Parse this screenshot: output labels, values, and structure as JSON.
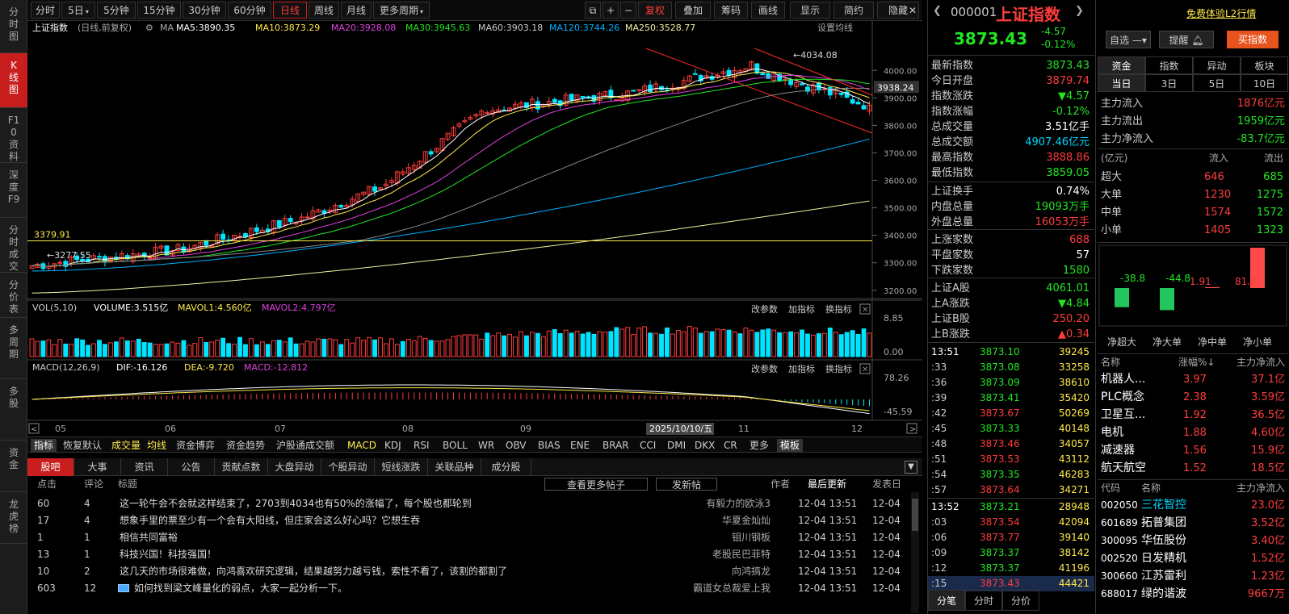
{
  "left_nav": [
    "分时图",
    "K线图",
    "F10资料",
    "深度F9",
    "分时成交",
    "分价表",
    "多周期",
    "多股",
    "资金",
    "龙虎榜"
  ],
  "toolbar": {
    "periods": [
      "分时",
      "5日",
      "5分钟",
      "15分钟",
      "30分钟",
      "60分钟",
      "日线",
      "周线",
      "月线",
      "更多周期"
    ],
    "active": "日线",
    "tools": [
      "复权",
      "叠加",
      "筹码",
      "画线",
      "显示",
      "简约",
      "隐藏"
    ]
  },
  "chart_info": {
    "name": "上证指数",
    "mode": "(日线,前复权)",
    "ma_label": "MA",
    "ma5": "MA5:3890.35",
    "ma10": "MA10:3873.29",
    "ma20": "MA20:3928.08",
    "ma30": "MA30:3945.63",
    "ma60": "MA60:3903.18",
    "ma120": "MA120:3744.26",
    "ma250": "MA250:3528.77",
    "set_ma": "设置均线",
    "current_price_tag": "3938.24",
    "high_note": "4034.08",
    "low_note": "3277.55",
    "hline_label": "3379.91",
    "cursor_date": "2025/10/10/五"
  },
  "colors": {
    "up": "#ff3c3c",
    "down": "#00e5ff",
    "ma5": "#ffffff",
    "ma10": "#ffe94a",
    "ma20": "#e040e0",
    "ma30": "#22e522",
    "ma60": "#888888",
    "ma120": "#00aeff",
    "ma250": "#f0f0a0"
  },
  "vol_info": {
    "label": "VOL(5,10)",
    "volume": "VOLUME:3.515亿",
    "mavol1": "MAVOL1:4.560亿",
    "mavol2": "MAVOL2:4.797亿",
    "ticks": [
      "8.85",
      "0.00"
    ]
  },
  "macd_info": {
    "label": "MACD(12,26,9)",
    "dif": "DIF:-16.126",
    "dea": "DEA:-9.720",
    "macd": "MACD:-12.812",
    "ticks": [
      "78.26",
      "-45.59"
    ]
  },
  "panel_buttons": [
    "改参数",
    "加指标",
    "换指标"
  ],
  "chart_data": {
    "type": "candlestick",
    "x_labels": [
      "05",
      "06",
      "07",
      "08",
      "09",
      "10",
      "11",
      "12"
    ],
    "y_ticks": [
      4000,
      3900,
      3800,
      3700,
      3600,
      3500,
      3400,
      3300,
      3200
    ],
    "ylim": [
      3170,
      4080
    ],
    "high": 4034.08,
    "low": 3277.55,
    "hline": 3379.91,
    "last_close": 3873.43
  },
  "indicators": [
    "指标",
    "恢复默认",
    "成交量",
    "均线",
    "资金博弈",
    "资金趋势",
    "沪股通成交额",
    "MACD",
    "KDJ",
    "RSI",
    "BOLL",
    "WR",
    "OBV",
    "BIAS",
    "ENE",
    "BRAR",
    "CCI",
    "DMI",
    "DKX",
    "CR",
    "更多",
    "模板"
  ],
  "news_tabs": [
    "股吧",
    "大事",
    "资讯",
    "公告",
    "贡献点数",
    "大盘异动",
    "个股异动",
    "短线涨跌",
    "关联品种",
    "成分股"
  ],
  "news_header": {
    "clicks": "点击",
    "comments": "评论",
    "title": "标题",
    "more": "查看更多帖子",
    "post": "发新帖",
    "author": "作者",
    "updated": "最后更新",
    "posted": "发表日"
  },
  "news": [
    {
      "clicks": "60",
      "comments": "4",
      "title": "这一轮牛会不会就这样结束了，2703到4034也有50%的涨幅了，每个股也都轮到",
      "author": "有毅力的欧泳3",
      "updated": "12-04 13:51",
      "posted": "12-04"
    },
    {
      "clicks": "17",
      "comments": "4",
      "title": "想象手里的票至少有一个会有大阳线，但庄家会这么好心吗？它想生吞",
      "author": "华夏金灿灿",
      "updated": "12-04 13:51",
      "posted": "12-04"
    },
    {
      "clicks": "1",
      "comments": "1",
      "title": "相信共同富裕",
      "author": "钼川钢板",
      "updated": "12-04 13:51",
      "posted": "12-04"
    },
    {
      "clicks": "13",
      "comments": "1",
      "title": "科技兴国！科技强国！",
      "author": "老股民巴菲特",
      "updated": "12-04 13:51",
      "posted": "12-04"
    },
    {
      "clicks": "10",
      "comments": "2",
      "title": "这几天的市场很难做，向鸿喜欢研究逻辑，结果越努力越亏钱，索性不看了，该割的都割了",
      "author": "向鸿搞龙",
      "updated": "12-04 13:51",
      "posted": "12-04"
    },
    {
      "clicks": "603",
      "comments": "12",
      "title": "如何找到梁文峰量化的弱点，大家一起分析一下。",
      "author": "霸道女总裁爱上我",
      "updated": "12-04 13:51",
      "posted": "12-04"
    }
  ],
  "quote": {
    "code": "000001",
    "name": "上证指数",
    "price": "3873.43",
    "change": "-4.57",
    "pct": "-0.12%",
    "rows": [
      {
        "k": "最新指数",
        "v": "3873.43",
        "c": "green"
      },
      {
        "k": "今日开盘",
        "v": "3879.74",
        "c": "red"
      },
      {
        "k": "指数涨跌",
        "v": "▼4.57",
        "c": "green"
      },
      {
        "k": "指数涨幅",
        "v": "-0.12%",
        "c": "green"
      },
      {
        "k": "总成交量",
        "v": "3.51亿手",
        "c": "white"
      },
      {
        "k": "总成交额",
        "v": "4907.46亿元",
        "c": "cyan"
      },
      {
        "k": "最高指数",
        "v": "3888.86",
        "c": "red"
      },
      {
        "k": "最低指数",
        "v": "3859.05",
        "c": "green"
      },
      {
        "k": "上证换手",
        "v": "0.74%",
        "c": "white"
      },
      {
        "k": "内盘总量",
        "v": "19093万手",
        "c": "green"
      },
      {
        "k": "外盘总量",
        "v": "16053万手",
        "c": "red"
      },
      {
        "k": "上涨家数",
        "v": "688",
        "c": "red"
      },
      {
        "k": "平盘家数",
        "v": "57",
        "c": "white"
      },
      {
        "k": "下跌家数",
        "v": "1580",
        "c": "green"
      },
      {
        "k": "上证A股",
        "v": "4061.01",
        "c": "green"
      },
      {
        "k": "上A涨跌",
        "v": "▼4.84",
        "c": "green"
      },
      {
        "k": "上证B股",
        "v": "250.20",
        "c": "red"
      },
      {
        "k": "上B涨跌",
        "v": "▲0.34",
        "c": "red"
      }
    ],
    "ticks1_time": "13:51",
    "ticks1": [
      {
        "t": "13:51",
        "p": "3873.10",
        "q": "39245"
      },
      {
        "t": ":33",
        "p": "3873.08",
        "q": "33258"
      },
      {
        "t": ":36",
        "p": "3873.09",
        "q": "38610"
      },
      {
        "t": ":39",
        "p": "3873.41",
        "q": "35420"
      },
      {
        "t": ":42",
        "p": "3873.67",
        "q": "50269"
      },
      {
        "t": ":45",
        "p": "3873.33",
        "q": "40148"
      },
      {
        "t": ":48",
        "p": "3873.46",
        "q": "34057"
      },
      {
        "t": ":51",
        "p": "3873.53",
        "q": "43112"
      },
      {
        "t": ":54",
        "p": "3873.35",
        "q": "46283"
      },
      {
        "t": ":57",
        "p": "3873.64",
        "q": "34271"
      }
    ],
    "ticks2": [
      {
        "t": "13:52",
        "p": "3873.21",
        "q": "28948"
      },
      {
        "t": ":03",
        "p": "3873.54",
        "q": "42094"
      },
      {
        "t": ":06",
        "p": "3873.77",
        "q": "39140"
      },
      {
        "t": ":09",
        "p": "3873.37",
        "q": "38142"
      },
      {
        "t": ":12",
        "p": "3873.37",
        "q": "41196"
      },
      {
        "t": ":15",
        "p": "3873.43",
        "q": "44421"
      }
    ],
    "bottom_tabs": [
      "分笔",
      "分时",
      "分价"
    ]
  },
  "fund": {
    "top_link": "免费体验L2行情",
    "watch": "自选",
    "alert": "提醒",
    "buy": "买指数",
    "tabs1": [
      "资金",
      "指数",
      "异动",
      "板块"
    ],
    "tabs2": [
      "当日",
      "3日",
      "5日",
      "10日"
    ],
    "flows": [
      {
        "k": "主力流入",
        "v": "1876亿元",
        "c": "red"
      },
      {
        "k": "主力流出",
        "v": "1959亿元",
        "c": "green"
      },
      {
        "k": "主力净流入",
        "v": "-83.7亿元",
        "c": "green"
      }
    ],
    "flow_head": {
      "unit": "(亿元)",
      "in": "流入",
      "out": "流出"
    },
    "flow_rows": [
      {
        "k": "超大",
        "in": "646",
        "out": "685"
      },
      {
        "k": "大单",
        "in": "1230",
        "out": "1275"
      },
      {
        "k": "中单",
        "in": "1574",
        "out": "1572"
      },
      {
        "k": "小单",
        "in": "1405",
        "out": "1323"
      }
    ],
    "bars": [
      {
        "label": "净超大",
        "value": -38.8,
        "text": "-38.8"
      },
      {
        "label": "净大单",
        "value": -44.8,
        "text": "-44.8"
      },
      {
        "label": "净中单",
        "value": 1.91,
        "text": "1.91"
      },
      {
        "label": "净小单",
        "value": 81.8,
        "text": "81.8"
      }
    ],
    "sector_head": {
      "name": "名称",
      "pct": "涨幅%↓",
      "net": "主力净流入"
    },
    "sectors": [
      {
        "n": "机器人...",
        "p": "3.97",
        "v": "37.1亿"
      },
      {
        "n": "PLC概念",
        "p": "2.38",
        "v": "3.59亿"
      },
      {
        "n": "卫星互...",
        "p": "1.92",
        "v": "36.5亿"
      },
      {
        "n": "电机",
        "p": "1.88",
        "v": "4.60亿"
      },
      {
        "n": "减速器",
        "p": "1.56",
        "v": "15.9亿"
      },
      {
        "n": "航天航空",
        "p": "1.52",
        "v": "18.5亿"
      }
    ],
    "stock_head": {
      "code": "代码",
      "name": "名称",
      "net": "主力净流入"
    },
    "stocks": [
      {
        "c": "002050",
        "n": "三花智控",
        "v": "23.0亿"
      },
      {
        "c": "601689",
        "n": "拓普集团",
        "v": "3.52亿"
      },
      {
        "c": "300095",
        "n": "华伍股份",
        "v": "3.40亿"
      },
      {
        "c": "002520",
        "n": "日发精机",
        "v": "1.52亿"
      },
      {
        "c": "300660",
        "n": "江苏雷利",
        "v": "1.23亿"
      },
      {
        "c": "688017",
        "n": "绿的谐波",
        "v": "9667万"
      }
    ]
  }
}
